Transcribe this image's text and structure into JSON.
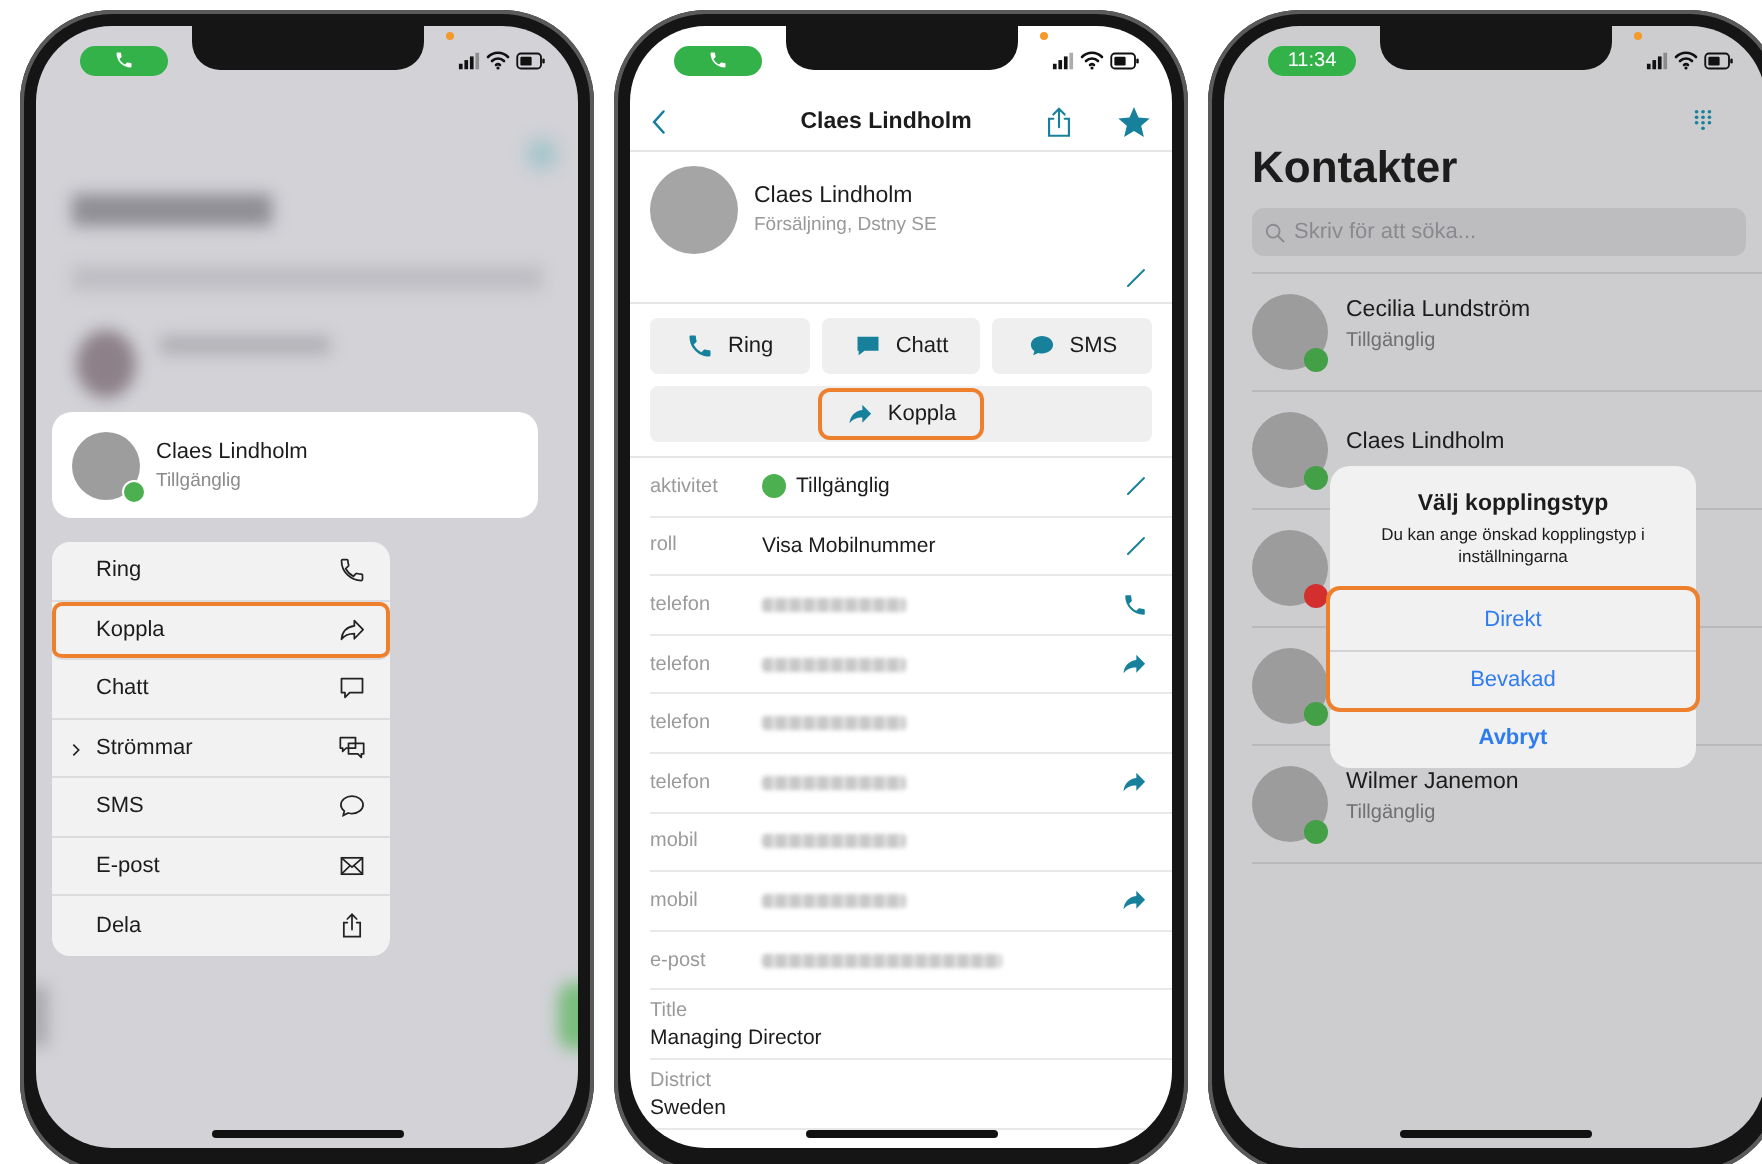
{
  "menu_screen": {
    "status_bar": {
      "pill": {
        "kind": "call"
      }
    },
    "preview": {
      "name": "Claes Lindholm",
      "status": "Tillgänglig"
    },
    "menu": [
      {
        "label": "Ring",
        "kind": "phone",
        "highlighted": false,
        "submenu": false
      },
      {
        "label": "Koppla",
        "kind": "forward",
        "highlighted": true,
        "submenu": false
      },
      {
        "label": "Chatt",
        "kind": "chat",
        "highlighted": false,
        "submenu": false
      },
      {
        "label": "Strömmar",
        "kind": "chats",
        "highlighted": false,
        "submenu": true
      },
      {
        "label": "SMS",
        "kind": "sms",
        "highlighted": false,
        "submenu": false
      },
      {
        "label": "E-post",
        "kind": "mail",
        "highlighted": false,
        "submenu": false
      },
      {
        "label": "Dela",
        "kind": "share",
        "highlighted": false,
        "submenu": false
      }
    ]
  },
  "contact_screen": {
    "status_bar": {
      "pill": {
        "kind": "call"
      }
    },
    "nav": {
      "title": "Claes Lindholm"
    },
    "profile": {
      "name": "Claes Lindholm",
      "subtitle": "Försäljning, Dstny SE"
    },
    "actions": [
      {
        "label": "Ring",
        "kind": "phone"
      },
      {
        "label": "Chatt",
        "kind": "chat"
      },
      {
        "label": "SMS",
        "kind": "sms"
      }
    ],
    "transfer_button": {
      "label": "Koppla",
      "highlighted": true
    },
    "fields": [
      {
        "label": "aktivitet",
        "kind": "presence",
        "value": "Tillgänglig",
        "editable": true,
        "callable": false,
        "transferable": false
      },
      {
        "label": "roll",
        "kind": "text",
        "value": "Visa Mobilnummer",
        "editable": true,
        "callable": false,
        "transferable": false
      },
      {
        "label": "telefon",
        "kind": "blurred_phone",
        "editable": false,
        "callable": true,
        "transferable": false
      },
      {
        "label": "telefon",
        "kind": "blurred_phone",
        "editable": false,
        "callable": false,
        "transferable": true
      },
      {
        "label": "telefon",
        "kind": "blurred_phone",
        "editable": false,
        "callable": false,
        "transferable": false
      },
      {
        "label": "telefon",
        "kind": "blurred_phone",
        "editable": false,
        "callable": false,
        "transferable": true
      },
      {
        "label": "mobil",
        "kind": "blurred_phone",
        "editable": false,
        "callable": false,
        "transferable": false
      },
      {
        "label": "mobil",
        "kind": "blurred_phone",
        "editable": false,
        "callable": false,
        "transferable": true
      },
      {
        "label": "e-post",
        "kind": "blurred_email",
        "editable": false,
        "callable": false,
        "transferable": false
      }
    ],
    "details": [
      {
        "label": "Title",
        "value": "Managing Director"
      },
      {
        "label": "District",
        "value": "Sweden"
      }
    ]
  },
  "contacts_screen": {
    "status_bar": {
      "pill": {
        "kind": "clock",
        "time": "11:34"
      }
    },
    "title": "Kontakter",
    "search": {
      "placeholder": "Skriv för att söka..."
    },
    "contacts": [
      {
        "name": "Cecilia Lundström",
        "status": "Tillgänglig",
        "color": "#43a047"
      },
      {
        "name": "Claes Lindholm",
        "color": "#43a047"
      },
      {
        "color": "#d32f2f"
      },
      {
        "color": "#43a047"
      },
      {
        "name": "Wilmer Janemon",
        "status": "Tillgänglig",
        "color": "#43a047"
      }
    ],
    "dialog": {
      "title": "Välj kopplingstyp",
      "message": "Du kan ange önskad kopplingstyp i inställningarna",
      "options": [
        {
          "label": "Direkt",
          "kind": "default",
          "highlighted": true
        },
        {
          "label": "Bevakad",
          "kind": "default",
          "highlighted": true
        },
        {
          "label": "Avbryt",
          "kind": "cancel",
          "highlighted": false
        }
      ]
    }
  }
}
